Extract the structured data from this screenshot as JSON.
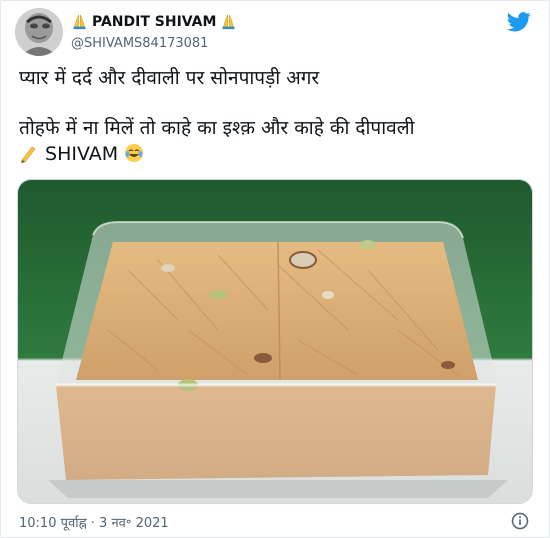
{
  "author": {
    "display_name": "PANDIT SHIVAM",
    "handle": "@SHIVAMS84173081"
  },
  "tweet": {
    "line1": "प्यार में दर्द और दीवाली पर सोनपापड़ी अगर",
    "line2": "तोहफे में ना मिलें तो काहे का इश्क़ और काहे की दीपावली",
    "signature": "SHIVAM"
  },
  "media": {
    "alt": "soan papdi in plastic box"
  },
  "meta": {
    "timestamp": "10:10 पूर्वाह्न · 3 नव॰ 2021"
  },
  "colors": {
    "twitter_blue": "#1d9bf0",
    "secondary_text": "#536471",
    "background": "#ffffff"
  },
  "icons": {
    "brand": "twitter-bird-icon",
    "info": "info-icon",
    "pen": "writing-hand-emoji",
    "laugh": "tears-of-joy-emoji",
    "hands": "folded-hands-emoji"
  }
}
